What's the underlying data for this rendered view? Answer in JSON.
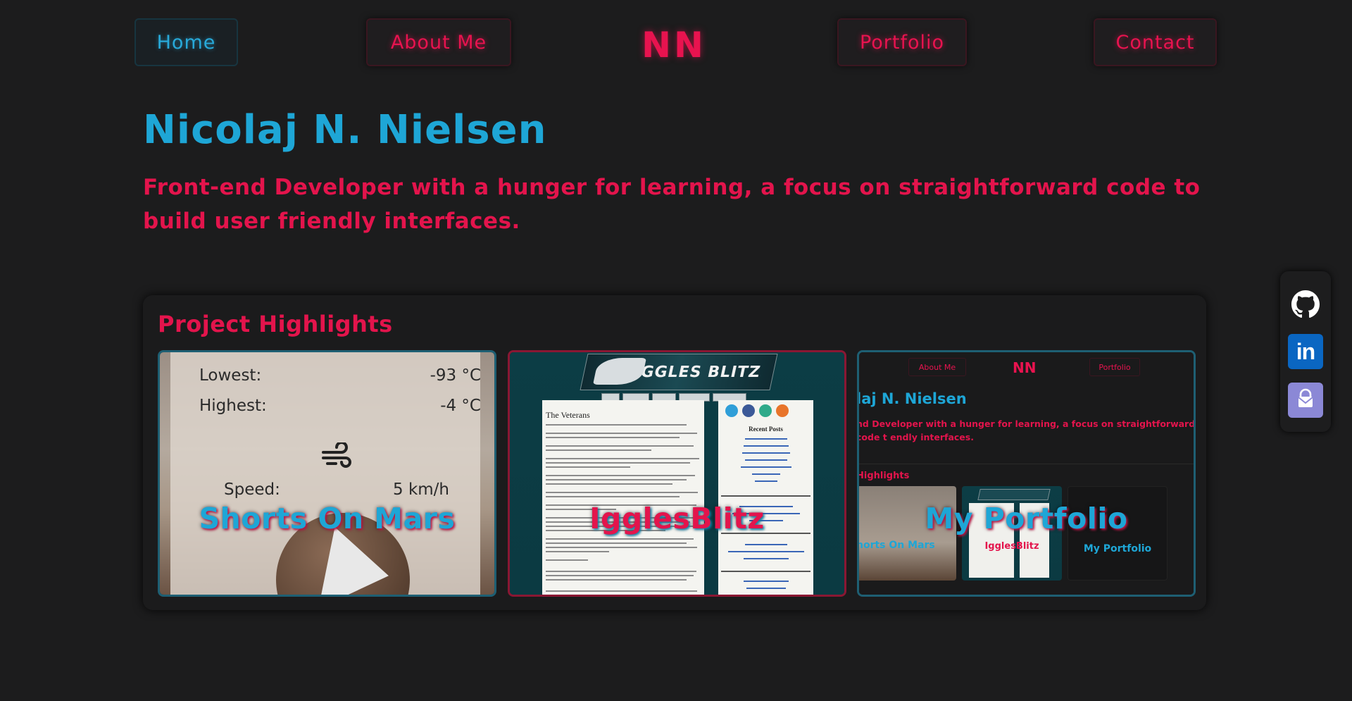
{
  "nav": {
    "home": "Home",
    "about": "About Me",
    "logo": "NN",
    "portfolio": "Portfolio",
    "contact": "Contact"
  },
  "hero": {
    "title": "Nicolaj N. Nielsen",
    "subtitle": "Front-end Developer with a hunger for learning, a focus on straightforward code to build user friendly interfaces."
  },
  "projects": {
    "heading": "Project Highlights",
    "cards": [
      {
        "label": "Shorts On Mars",
        "preview": {
          "rows": [
            {
              "label": "Lowest:",
              "value": "-93 °C"
            },
            {
              "label": "Highest:",
              "value": "-4 °C"
            },
            {
              "label": "Speed:",
              "value": "5 km/h"
            }
          ],
          "icon": "wind-icon"
        }
      },
      {
        "label": "IgglesBlitz",
        "preview": {
          "banner": "IGGLES BLITZ",
          "article_title": "The Veterans",
          "sidebar_heading": "Recent Posts"
        }
      },
      {
        "label": "My Portfolio",
        "preview": {
          "nav_about": "About Me",
          "nav_logo": "NN",
          "nav_portfolio": "Portfolio",
          "title": "laj N. Nielsen",
          "subtitle": "nd Developer with a hunger for learning, a focus on straightforward code t endly interfaces.",
          "highlights": "Highlights",
          "mini_labels": [
            "horts On Mars",
            "IgglesBlitz",
            "My Portfolio"
          ]
        }
      }
    ]
  },
  "social": {
    "items": [
      "github-icon",
      "linkedin-icon",
      "protonmail-icon"
    ],
    "linkedin_text": "in"
  },
  "colors": {
    "background": "#1c1c1d",
    "accent_pink": "#e3144c",
    "accent_blue": "#1ea6d6"
  }
}
